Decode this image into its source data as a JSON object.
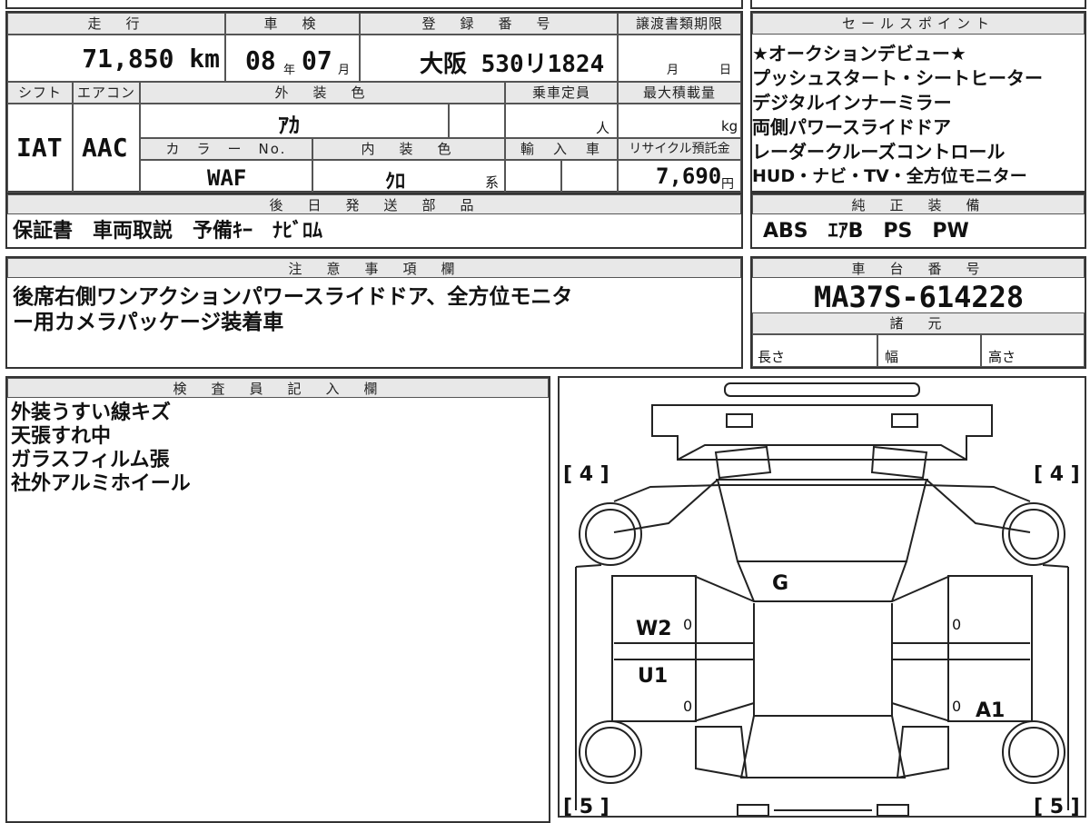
{
  "header": {
    "mileage_label": "走　行",
    "inspection_label": "車　検",
    "registration_label": "登　録　番　号",
    "transfer_deadline_label": "譲渡書類期限",
    "sales_points_label": "セールスポイント"
  },
  "vehicle": {
    "mileage": "71,850 km",
    "inspection_year": "08",
    "year_unit": "年",
    "inspection_month": "07",
    "month_unit": "月",
    "registration": "大阪 530リ1824",
    "deadline_month_unit": "月",
    "deadline_day_unit": "日",
    "shift_label": "シフト",
    "aircon_label": "エアコン",
    "exterior_color_label": "外　装　色",
    "capacity_label": "乗車定員",
    "max_load_label": "最大積載量",
    "shift": "IAT",
    "aircon": "AAC",
    "exterior_color": "ｱｶ",
    "capacity_unit": "人",
    "load_unit": "kg",
    "color_no_label": "カ　ラ　ー　No.",
    "interior_color_label": "内　装　色",
    "import_label": "輸　入　車",
    "recycle_label": "リサイクル預託金",
    "color_no": "WAF",
    "interior_color": "ｸﾛ",
    "interior_suffix": "系",
    "recycle_fee": "7,690",
    "recycle_unit": "円"
  },
  "sales_points": [
    "★オークションデビュー★",
    "プッシュスタート・シートヒーター",
    "デジタルインナーミラー",
    "両側パワースライドドア",
    "レーダークルーズコントロール",
    "HUD・ナビ・TV・全方位モニター"
  ],
  "later_parts": {
    "label": "後　日　発　送　部　品",
    "value": "保証書　車両取説　予備ｷｰ　ﾅﾋﾞﾛﾑ"
  },
  "genuine_equipment": {
    "label": "純　正　装　備",
    "value": "ABS　ｴｱB　PS　PW"
  },
  "notes": {
    "label": "注　意　事　項　欄",
    "lines": [
      "後席右側ワンアクションパワースライドドア、全方位モニタ",
      "ー用カメラパッケージ装着車"
    ]
  },
  "chassis": {
    "label": "車　台　番　号",
    "value": "MA37S-614228",
    "specs_label": "諸　元",
    "length_label": "長さ",
    "width_label": "幅",
    "height_label": "高さ"
  },
  "inspector": {
    "label": "検　査　員　記　入　欄",
    "lines": [
      "外装うすい線キズ",
      "天張すれ中",
      "ガラスフィルム張",
      "社外アルミホイール"
    ]
  },
  "diagram": {
    "tire_tl": "[ 4 ]",
    "tire_tr": "[ 4 ]",
    "tire_bl": "[ 5 ]",
    "tire_br": "[ 5 ]",
    "mark_g": "G",
    "mark_w2": "W2",
    "mark_u1": "U1",
    "mark_a1": "A1",
    "zero1": "0",
    "zero2": "0",
    "zero3": "0",
    "zero4": "0"
  }
}
